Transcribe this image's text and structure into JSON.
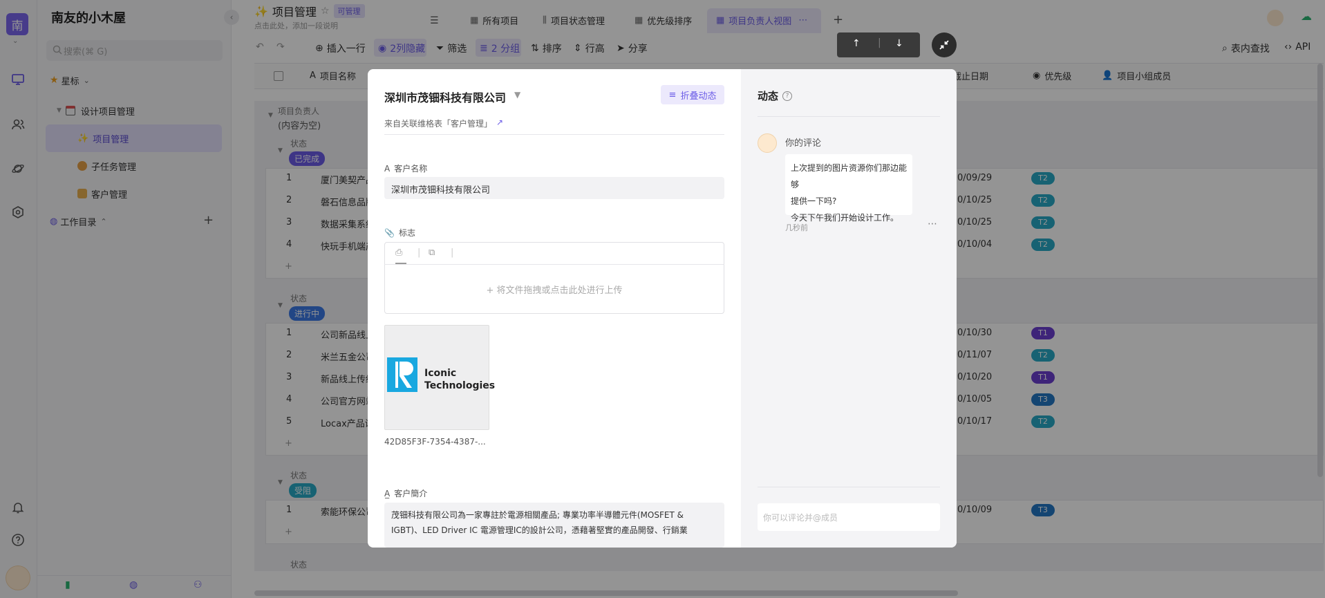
{
  "rail": {
    "logo_char": "南",
    "icons": [
      "monitor-icon",
      "users-icon",
      "planet-icon",
      "hexagon-settings-icon",
      "bell-icon",
      "help-icon",
      "avatar"
    ]
  },
  "sidebar": {
    "space_name": "南友的小木屋",
    "search_placeholder": "搜索(⌘ G)",
    "starred": "星标",
    "folder": "设计项目管理",
    "items": [
      {
        "label": "项目管理"
      },
      {
        "label": "子任务管理"
      },
      {
        "label": "客户管理"
      }
    ],
    "catalog": "工作目录"
  },
  "header": {
    "title": "项目管理",
    "permission": "可管理",
    "desc_placeholder": "点击此处，添加一段说明",
    "views": [
      "所有项目",
      "项目状态管理",
      "优先级排序",
      "项目负责人视图"
    ]
  },
  "toolbar": {
    "insert_row": "插入一行",
    "hidden": "2列隐藏",
    "filter": "筛选",
    "group": "2 分组",
    "sort": "排序",
    "row_height": "行高",
    "share": "分享",
    "find": "表内查找",
    "api": "API"
  },
  "table": {
    "headers": {
      "name": "项目名称",
      "deadline": "截止日期",
      "priority": "优先级",
      "members": "项目小组成员"
    },
    "group_owner_label": "项目负责人",
    "group_owner_value": "(内容为空)",
    "status_label": "状态",
    "groups": [
      {
        "status": "已完成",
        "color": "#6b5ce7",
        "rows": [
          {
            "idx": "1",
            "name": "厦门美契产品",
            "date": "0/09/29",
            "pri": "T2",
            "pri_color": "#29a9c6"
          },
          {
            "idx": "2",
            "name": "磐石信息品牌",
            "date": "0/10/25",
            "pri": "T2",
            "pri_color": "#29a9c6"
          },
          {
            "idx": "3",
            "name": "数据采集系统",
            "date": "0/10/25",
            "pri": "T2",
            "pri_color": "#29a9c6"
          },
          {
            "idx": "4",
            "name": "快玩手机端产",
            "date": "0/10/04",
            "pri": "T2",
            "pri_color": "#29a9c6"
          }
        ]
      },
      {
        "status": "进行中",
        "color": "#3b79e6",
        "rows": [
          {
            "idx": "1",
            "name": "公司新品线上",
            "date": "0/10/30",
            "pri": "T1",
            "pri_color": "#6b3fd1"
          },
          {
            "idx": "2",
            "name": "米兰五金公司",
            "date": "0/11/07",
            "pri": "T2",
            "pri_color": "#29a9c6"
          },
          {
            "idx": "3",
            "name": "新品线上传统",
            "date": "0/10/20",
            "pri": "T1",
            "pri_color": "#6b3fd1"
          },
          {
            "idx": "4",
            "name": "公司官方网站",
            "date": "0/10/05",
            "pri": "T3",
            "pri_color": "#2477c4"
          },
          {
            "idx": "5",
            "name": "Locax产品设",
            "date": "0/10/17",
            "pri": "T2",
            "pri_color": "#29a9c6"
          }
        ]
      },
      {
        "status": "受阻",
        "color": "#29a9c6",
        "rows": [
          {
            "idx": "1",
            "name": "索能环保公司",
            "date": "0/10/09",
            "pri": "T3",
            "pri_color": "#2477c4"
          }
        ]
      }
    ],
    "add_row": "+"
  },
  "modal": {
    "title": "深圳市茂钿科技有限公司",
    "collapse_activity": "折叠动态",
    "source": "来自关联维格表「客户管理」",
    "fields": {
      "customer_name_label": "客户名称",
      "customer_name_value": "深圳市茂钿科技有限公司",
      "logo_label": "标志",
      "upload_hint": "+ 将文件拖拽或点击此处进行上传",
      "logo_company_line1": "Iconic",
      "logo_company_line2": "Technologies",
      "attachment_name": "42D85F3F-7354-4387-...",
      "intro_label": "客户簡介",
      "intro_line1": "茂钿科技有限公司為一家專註於電源相關產品; 專業功率半導體元件(MOSFET &",
      "intro_line2": "IGBT)、LED Driver IC 電源管理IC的設計公司，憑藉著堅實的產品開發、行銷業"
    },
    "activity": {
      "title": "动态",
      "comment_author": "你的评论",
      "comment_line1": "上次提到的图片资源你们那边能够",
      "comment_line2": "提供一下吗?",
      "comment_line3": "今天下午我们开始设计工作。",
      "comment_time": "几秒前",
      "comment_input_placeholder": "你可以评论并@成员"
    }
  }
}
